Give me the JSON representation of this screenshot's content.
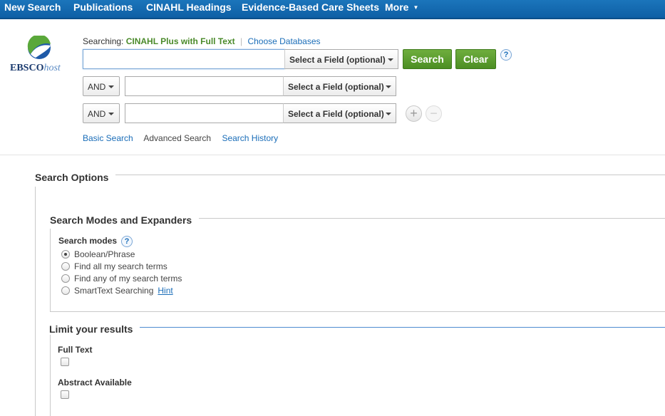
{
  "nav": {
    "items": [
      "New Search",
      "Publications",
      "CINAHL Headings",
      "Evidence-Based Care Sheets",
      "More"
    ]
  },
  "logo": {
    "brand": "EBSCO",
    "suffix": "host"
  },
  "searching": {
    "label": "Searching:",
    "database": "CINAHL Plus with Full Text",
    "choose": "Choose Databases"
  },
  "search": {
    "field_label": "Select a Field (optional)",
    "operator": "AND",
    "search_button": "Search",
    "clear_button": "Clear",
    "help": "?"
  },
  "links": {
    "basic": "Basic Search",
    "advanced": "Advanced Search",
    "history": "Search History"
  },
  "options": {
    "title": "Search Options",
    "modes_section": "Search Modes and Expanders",
    "modes_label": "Search modes",
    "modes": [
      "Boolean/Phrase",
      "Find all my search terms",
      "Find any of my search terms",
      "SmartText Searching"
    ],
    "selected_mode": "Boolean/Phrase",
    "hint": "Hint",
    "limit_title": "Limit your results",
    "full_text": "Full Text",
    "abstract": "Abstract Available"
  }
}
